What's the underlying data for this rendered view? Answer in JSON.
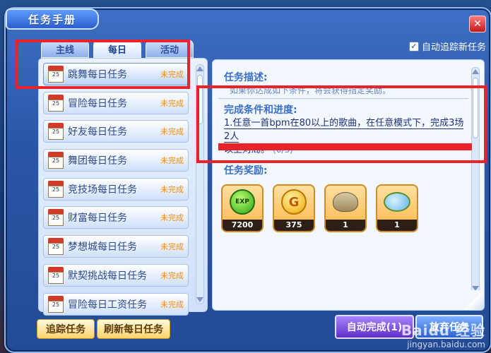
{
  "window": {
    "title": "任务手册",
    "close_label": "✕"
  },
  "tabs": [
    {
      "label": "主线",
      "active": false
    },
    {
      "label": "每日",
      "active": true
    },
    {
      "label": "活动",
      "active": false
    }
  ],
  "auto_track": {
    "label": "自动追踪新任务",
    "checked_mark": "✓"
  },
  "task_list": [
    {
      "name": "跳舞每日任务",
      "status": "未完成",
      "selected": true
    },
    {
      "name": "冒险每日任务",
      "status": "未完成"
    },
    {
      "name": "好友每日任务",
      "status": "未完成"
    },
    {
      "name": "舞团每日任务",
      "status": "未完成"
    },
    {
      "name": "竞技场每日任务",
      "status": "未完成"
    },
    {
      "name": "财富每日任务",
      "status": "未完成"
    },
    {
      "name": "梦想城每日任务",
      "status": "未完成"
    },
    {
      "name": "默契挑战每日任务",
      "status": "未完成"
    },
    {
      "name": "冒险每日工资任务",
      "status": "未完成"
    }
  ],
  "calendar_icon_text": "25",
  "detail": {
    "desc_title": "任务描述:",
    "desc_text": "如果你达成如下条件，将会获得指定奖励。",
    "cond_title": "完成条件和进度:",
    "cond_line1": "1.任意一首bpm在80以上的歌曲，在任意模式下，完成3场2人",
    "cond_line2": "以上对局。",
    "cond_progress": "(0/3)",
    "reward_title": "任务奖励:"
  },
  "rewards": [
    {
      "icon": "exp-icon",
      "label": "EXP",
      "count": "7200"
    },
    {
      "icon": "g-coin-icon",
      "label": "G",
      "count": "375"
    },
    {
      "icon": "bag-icon",
      "label": "",
      "count": "1"
    },
    {
      "icon": "gem-icon",
      "label": "",
      "count": "1"
    }
  ],
  "buttons": {
    "track": "追踪任务",
    "refresh": "刷新每日任务",
    "auto_complete": "自动完成(1)",
    "abandon": "放弃任务"
  },
  "watermark": {
    "brand": "Baidu 经验",
    "url": "jingyan.baidu.com"
  },
  "colors": {
    "highlight_red": "#e8232a",
    "status_orange": "#ff8a00",
    "window_blue": "#2a56a6"
  }
}
